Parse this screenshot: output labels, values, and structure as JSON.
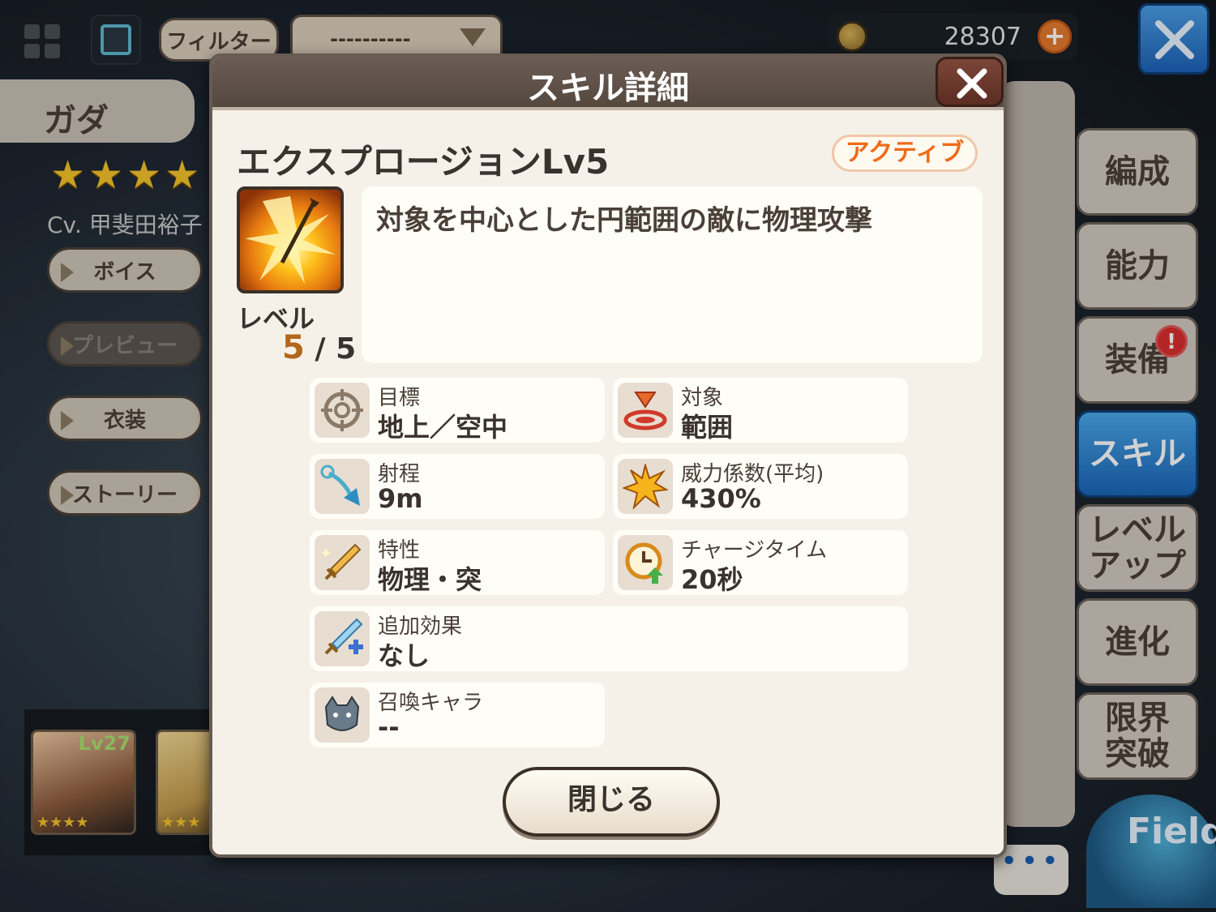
{
  "topbar": {
    "filter_label": "フィルター",
    "select_value": "----------",
    "currency_value": "28307",
    "plus_icon": "plus-icon",
    "close_icon": "close-icon"
  },
  "character": {
    "name": "ガダ",
    "stars": "★★★★",
    "cv": "Cv. 甲斐田裕子",
    "buttons": [
      "ボイス",
      "プレビュー",
      "衣装",
      "ストーリー"
    ]
  },
  "party": {
    "portrait1_level": "Lv27",
    "portrait1_stars": "★★★★",
    "portrait2_stars": "★★★"
  },
  "right_menu": {
    "items": [
      "編成",
      "能力",
      "装備",
      "スキル",
      "レベル\nアップ",
      "進化",
      "限界\n突破"
    ],
    "active_index": 3,
    "alert_badge": "!",
    "field_logo": "Field",
    "chat_dots": "•••"
  },
  "modal": {
    "title": "スキル詳細",
    "skill_name": "エクスプロージョンLv5",
    "skill_type": "アクティブ",
    "level_label": "レベル",
    "level_current": "5",
    "level_max": "/ 5",
    "description": "対象を中心とした円範囲の敵に物理攻撃",
    "stats": [
      {
        "label": "目標",
        "value": "地上／空中",
        "icon": "crosshair-icon"
      },
      {
        "label": "対象",
        "value": "範囲",
        "icon": "area-target-icon"
      },
      {
        "label": "射程",
        "value": "9m",
        "icon": "range-arrow-icon"
      },
      {
        "label": "威力係数(平均)",
        "value": "430%",
        "icon": "burst-icon"
      },
      {
        "label": "特性",
        "value": "物理・突",
        "icon": "sword-icon"
      },
      {
        "label": "チャージタイム",
        "value": "20秒",
        "icon": "clock-icon"
      },
      {
        "label": "追加効果",
        "value": "なし",
        "icon": "sword-plus-icon"
      },
      {
        "label": "召喚キャラ",
        "value": "--",
        "icon": "summon-icon"
      }
    ],
    "close_button": "閉じる"
  },
  "colors": {
    "active_tab": "#2a7fd4",
    "skill_type_text": "#f06a18",
    "header_bg": "#5e5047",
    "modal_bg": "#f6f1e8"
  }
}
